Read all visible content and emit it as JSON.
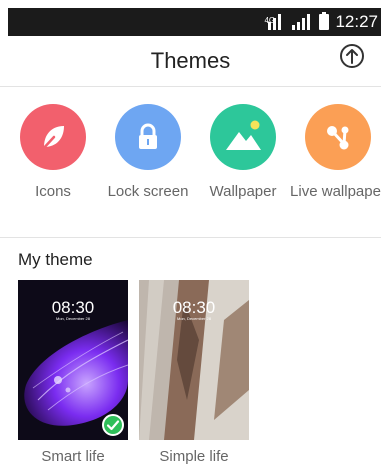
{
  "status_bar": {
    "network": "4G",
    "time": "12:27"
  },
  "header": {
    "title": "Themes",
    "upload_icon": "arrow-up-circle-icon"
  },
  "categories": [
    {
      "label": "Icons",
      "icon": "leaf-icon",
      "color": "#f2606d"
    },
    {
      "label": "Lock screen",
      "icon": "lock-icon",
      "color": "#6ea6f2"
    },
    {
      "label": "Wallpaper",
      "icon": "landscape-icon",
      "color": "#2dc79a"
    },
    {
      "label": "Live wallpaper",
      "icon": "share-nodes-icon",
      "color": "#fb9f55"
    }
  ],
  "my_theme": {
    "title": "My theme",
    "items": [
      {
        "label": "Smart life",
        "time": "08:30",
        "date": "Mon, December 28",
        "selected": true
      },
      {
        "label": "Simple life",
        "time": "08:30",
        "date": "Mon, December 28",
        "selected": false
      }
    ]
  }
}
